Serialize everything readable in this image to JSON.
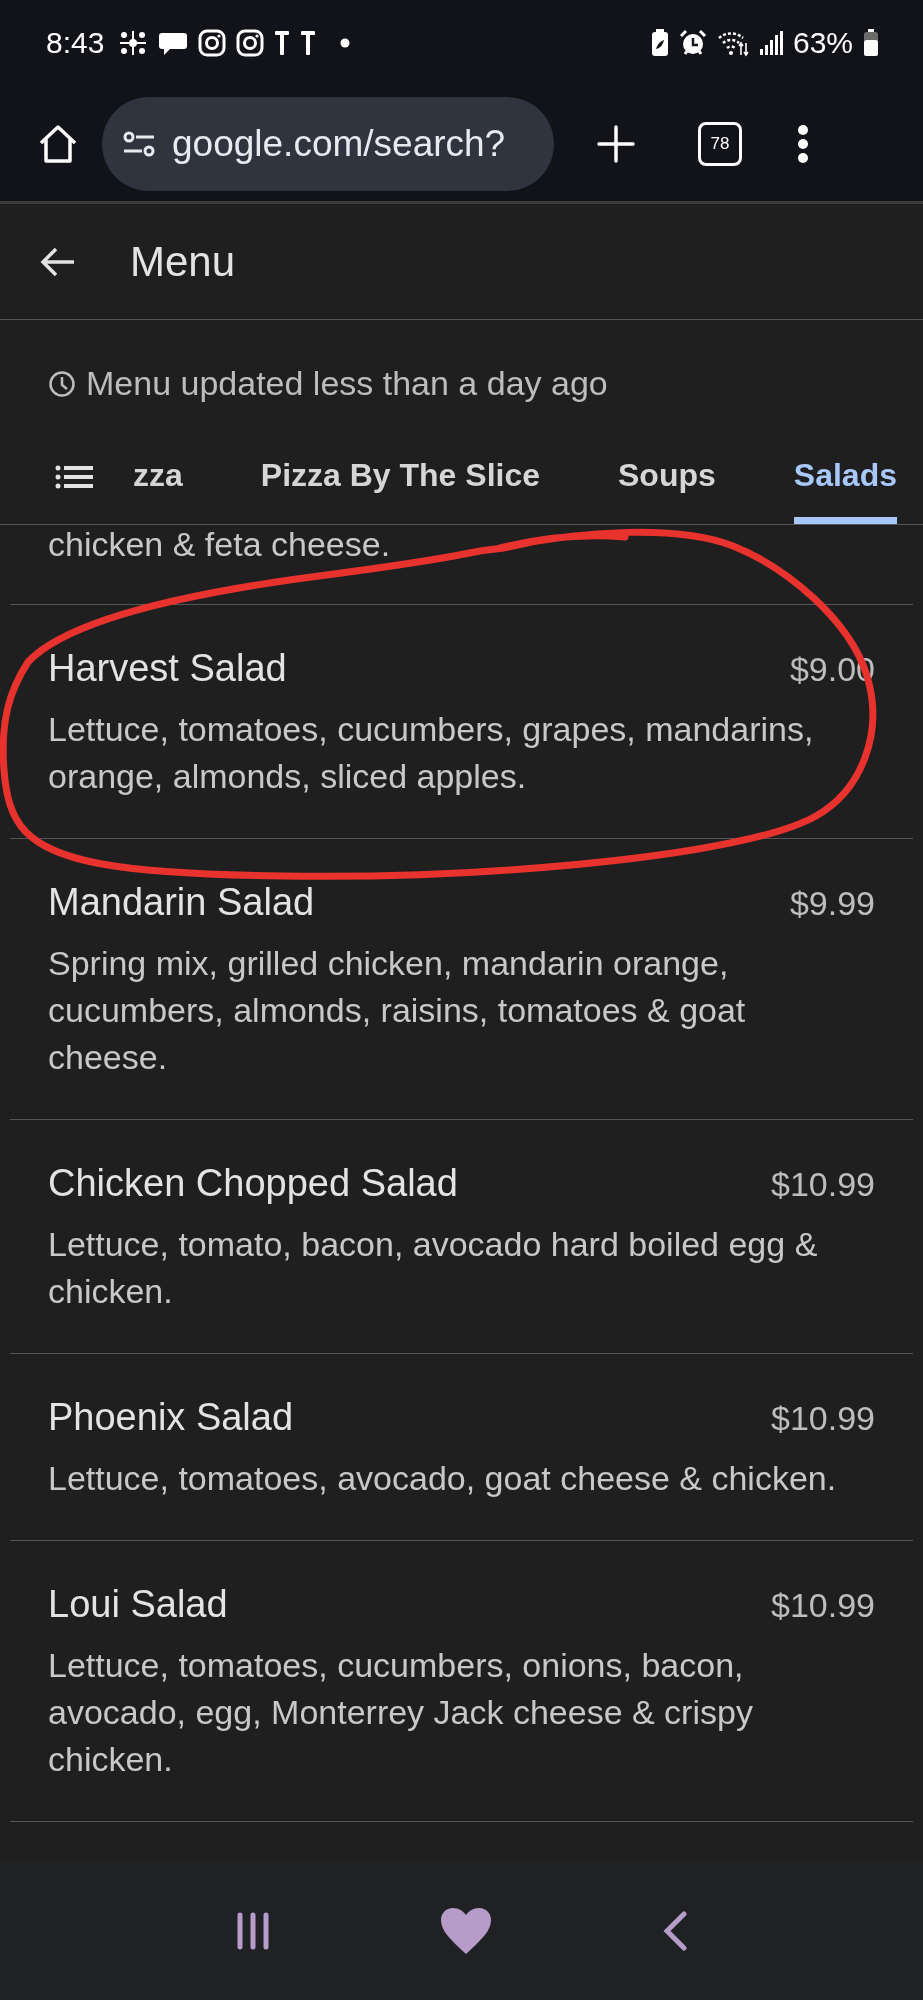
{
  "status_bar": {
    "time": "8:43",
    "battery": "63%"
  },
  "browser": {
    "url": "google.com/search?",
    "tab_count": "78"
  },
  "header": {
    "title": "Menu"
  },
  "updated_note": "Menu updated less than a day ago",
  "tabs": [
    {
      "label": "zza",
      "selected": false
    },
    {
      "label": "Pizza By The Slice",
      "selected": false
    },
    {
      "label": "Soups",
      "selected": false
    },
    {
      "label": "Salads",
      "selected": true
    }
  ],
  "partial_description": "chicken & feta cheese.",
  "items": [
    {
      "name": "Harvest Salad",
      "price": "$9.00",
      "description": "Lettuce, tomatoes, cucumbers, grapes, mandarins, orange, almonds, sliced apples."
    },
    {
      "name": "Mandarin Salad",
      "price": "$9.99",
      "description": "Spring mix, grilled chicken, mandarin orange, cucumbers, almonds, raisins, tomatoes & goat cheese."
    },
    {
      "name": "Chicken Chopped Salad",
      "price": "$10.99",
      "description": "Lettuce, tomato, bacon, avocado hard boiled egg & chicken."
    },
    {
      "name": "Phoenix Salad",
      "price": "$10.99",
      "description": "Lettuce, tomatoes, avocado, goat cheese & chicken."
    },
    {
      "name": "Loui Salad",
      "price": "$10.99",
      "description": "Lettuce, tomatoes, cucumbers, onions, bacon, avocado, egg, Monterrey Jack cheese & crispy chicken."
    }
  ],
  "annotation": {
    "kind": "freehand-circle"
  }
}
